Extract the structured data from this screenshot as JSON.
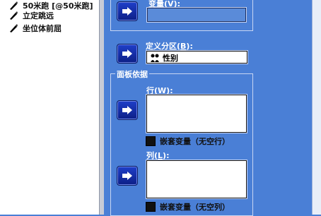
{
  "variable_list": {
    "items": [
      {
        "label": "50米跑 [@50米跑]",
        "icon": "scale-variable-icon"
      },
      {
        "label": "立定跳远",
        "icon": "scale-variable-icon"
      },
      {
        "label": "坐位体前屈",
        "icon": "scale-variable-icon"
      }
    ]
  },
  "form": {
    "variable_label": "变量(V):",
    "partition_label_pre": "定义分区(",
    "partition_label_key": "B",
    "partition_label_post": "):",
    "partition_value": "性别",
    "panel_group_title": "面板依据",
    "rows_label_pre": "行(",
    "rows_label_key": "W",
    "rows_label_post": "):",
    "rows_nest_label": "嵌套变量（无空行）",
    "cols_label_pre": "列(",
    "cols_label_key": "L",
    "cols_label_post": "):",
    "cols_nest_label": "嵌套变量（无空列）"
  },
  "colors": {
    "panel_bg": "#4a7fd6",
    "button": "#1a34b8"
  }
}
